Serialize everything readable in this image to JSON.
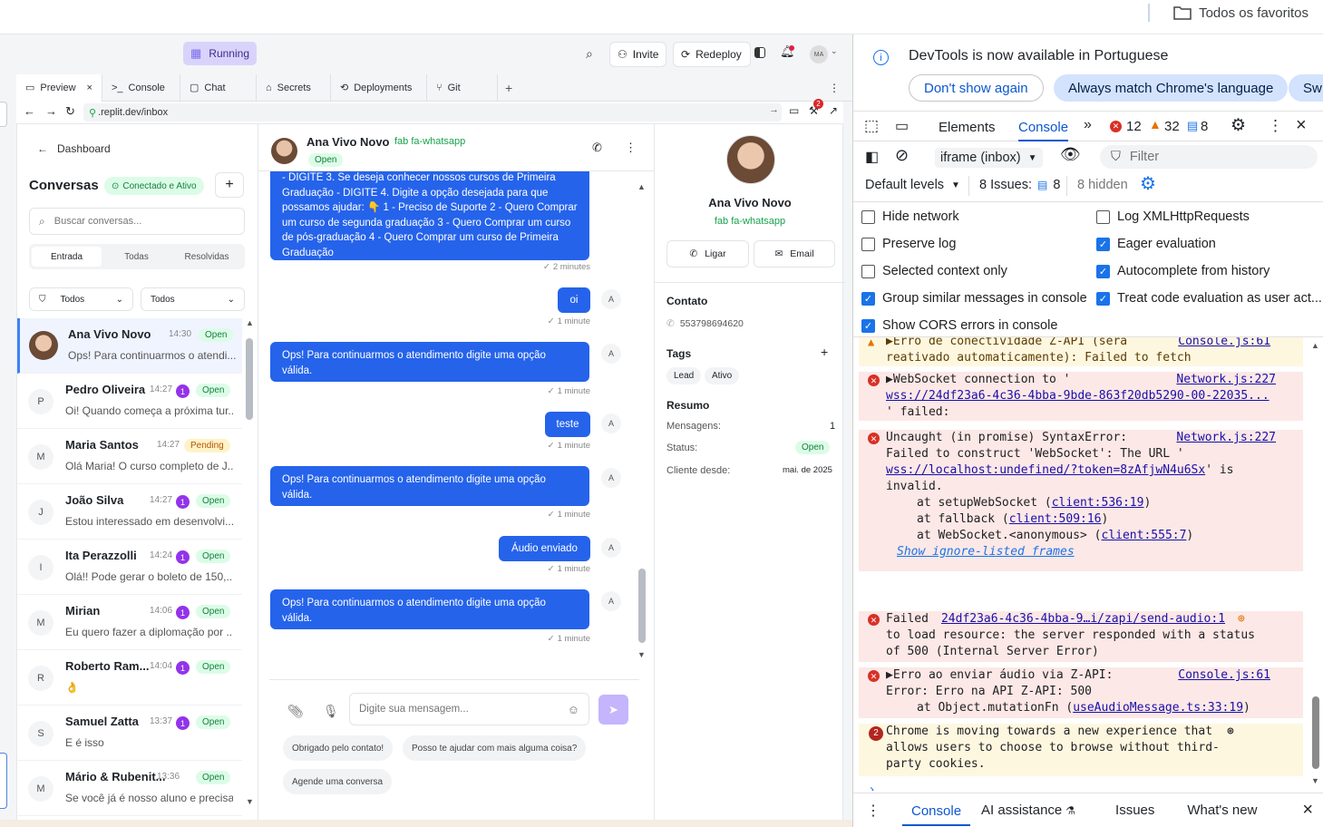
{
  "browser": {
    "favorites": "Todos os favoritos"
  },
  "replit": {
    "running": "Running",
    "invite": "Invite",
    "redeploy": "Redeploy",
    "avatar": "MA",
    "tabs": [
      {
        "label": "Preview"
      },
      {
        "label": "Console"
      },
      {
        "label": "Chat"
      },
      {
        "label": "Secrets"
      },
      {
        "label": "Deployments"
      },
      {
        "label": "Git"
      }
    ],
    "url": ".replit.dev/inbox",
    "notif_count": "2"
  },
  "sidebar": {
    "dashboard": "Dashboard",
    "title": "Conversas",
    "status": "Conectado e Ativo",
    "search_placeholder": "Buscar conversas...",
    "tabs": [
      "Entrada",
      "Todas",
      "Resolvidas"
    ],
    "filter1": "Todos",
    "filter2": "Todos",
    "conversations": [
      {
        "initial": "",
        "name": "Ana Vivo Novo",
        "time": "14:30",
        "count": "",
        "status": "Open",
        "preview": "Ops! Para continuarmos o atendi..."
      },
      {
        "initial": "P",
        "name": "Pedro Oliveira",
        "time": "14:27",
        "count": "1",
        "status": "Open",
        "preview": "Oi! Quando começa a próxima tur..."
      },
      {
        "initial": "M",
        "name": "Maria Santos",
        "time": "14:27",
        "count": "",
        "status": "Pending",
        "preview": "Olá Maria! O curso completo de J..."
      },
      {
        "initial": "J",
        "name": "João Silva",
        "time": "14:27",
        "count": "1",
        "status": "Open",
        "preview": "Estou interessado em desenvolvi..."
      },
      {
        "initial": "I",
        "name": "Ita Perazzolli",
        "time": "14:24",
        "count": "1",
        "status": "Open",
        "preview": "Olá!! Pode gerar o boleto de 150,..."
      },
      {
        "initial": "M",
        "name": "Mirian",
        "time": "14:06",
        "count": "1",
        "status": "Open",
        "preview": "Eu quero fazer a diplomação por ..."
      },
      {
        "initial": "R",
        "name": "Roberto Ram...",
        "time": "14:04",
        "count": "1",
        "status": "Open",
        "preview": "👌"
      },
      {
        "initial": "S",
        "name": "Samuel Zatta",
        "time": "13:37",
        "count": "1",
        "status": "Open",
        "preview": "E é isso"
      },
      {
        "initial": "M",
        "name": "Mário & Rubenit...",
        "time": "13:36",
        "count": "",
        "status": "Open",
        "preview": "Se você já é nosso aluno e precisa..."
      }
    ]
  },
  "chat": {
    "name": "Ana Vivo Novo",
    "channel": "fab fa-whatsapp",
    "status": "Open",
    "messages": [
      {
        "text": "- DIGITE 3. Se deseja conhecer nossos cursos de Primeira Graduação - DIGITE 4. Digite a opção desejada para que possamos ajudar: 👇 1 - Preciso de Suporte 2 - Quero Comprar um curso de segunda graduação 3 - Quero Comprar um curso de pós-graduação 4 - Quero Comprar um curso de Primeira Graduação",
        "meta": "2 minutes",
        "side": "left"
      },
      {
        "text": "oi",
        "meta": "1 minute",
        "side": "right"
      },
      {
        "text": "Ops! Para continuarmos o atendimento digite uma opção válida.",
        "meta": "1 minute",
        "side": "left"
      },
      {
        "text": "teste",
        "meta": "1 minute",
        "side": "right"
      },
      {
        "text": "Ops! Para continuarmos o atendimento digite uma opção válida.",
        "meta": "1 minute",
        "side": "left"
      },
      {
        "text": "Áudio enviado",
        "meta": "1 minute",
        "side": "right"
      },
      {
        "text": "Ops! Para continuarmos o atendimento digite uma opção válida.",
        "meta": "1 minute",
        "side": "left"
      }
    ],
    "avatar_letter": "A",
    "input_placeholder": "Digite sua mensagem...",
    "quick_replies": [
      "Obrigado pelo contato!",
      "Posso te ajudar com mais alguma coisa?",
      "Agende uma conversa"
    ]
  },
  "contact": {
    "name": "Ana Vivo Novo",
    "channel": "fab fa-whatsapp",
    "call": "Ligar",
    "email": "Email",
    "contact_title": "Contato",
    "phone": "553798694620",
    "tags_title": "Tags",
    "tags": [
      "Lead",
      "Ativo"
    ],
    "summary_title": "Resumo",
    "messages_label": "Mensagens:",
    "messages_value": "1",
    "status_label": "Status:",
    "status_value": "Open",
    "since_label": "Cliente desde:",
    "since_value": "mai. de 2025"
  },
  "devtools": {
    "banner": "DevTools is now available in Portuguese",
    "dont_show": "Don't show again",
    "match": "Always match Chrome's language",
    "switch": "Sw",
    "tabs": {
      "elements": "Elements",
      "console": "Console"
    },
    "errors": "12",
    "warnings": "32",
    "messages": "8",
    "context": "iframe (inbox)",
    "filter_placeholder": "Filter",
    "levels": "Default levels",
    "issues_label": "8 Issues:",
    "issues_count": "8",
    "hidden": "8 hidden",
    "settings": [
      {
        "label": "Hide network",
        "checked": false
      },
      {
        "label": "Log XMLHttpRequests",
        "checked": false
      },
      {
        "label": "Preserve log",
        "checked": false
      },
      {
        "label": "Eager evaluation",
        "checked": true
      },
      {
        "label": "Selected context only",
        "checked": false
      },
      {
        "label": "Autocomplete from history",
        "checked": true
      },
      {
        "label": "Group similar messages in console",
        "checked": true
      },
      {
        "label": "Treat code evaluation as user act...",
        "checked": true
      },
      {
        "label": "Show CORS errors in console",
        "checked": true
      }
    ],
    "log": {
      "m1": "▶Erro de conectividade Z-API (será",
      "m1b": "reativado automaticamente): Failed to fetch",
      "m1src": "Console.js:61",
      "m2": "▶WebSocket connection to '",
      "m2src": "Network.js:227",
      "m2url": "wss://24df23a6-4c36-4bba-9bde-863f20db5290-00-22035...",
      "m2end": "' failed:",
      "m3a": "Uncaught (in promise) SyntaxError:",
      "m3src": "Network.js:227",
      "m3b": "Failed to construct 'WebSocket': The URL '",
      "m3url": "wss://localhost:undefined/?token=8zAfjwN4u6Sx",
      "m3c": "' is",
      "m3d": "invalid.",
      "m3e": "at setupWebSocket (",
      "m3e_l": "client:536:19",
      "m3f": "at fallback (",
      "m3f_l": "client:509:16",
      "m3g": "at WebSocket.<anonymous> (",
      "m3g_l": "client:555:7",
      "m3h": "Show ignore-listed frames",
      "m4a": "Failed",
      "m4url": "24df23a6-4c36-4bba-9…i/zapi/send-audio:1",
      "m4b": "to load resource: the server responded with a status",
      "m4c": "of 500 (Internal Server Error)",
      "m5a": "▶Erro ao enviar áudio via Z-API:",
      "m5src": "Console.js:61",
      "m5b": "Error: Erro na API Z-API: 500",
      "m5c": "at Object.mutationFn (",
      "m5c_l": "useAudioMessage.ts:33:19",
      "m6count": "2",
      "m6a": "Chrome is moving towards a new experience that",
      "m6b": "allows users to choose to browse without third-",
      "m6c": "party cookies."
    },
    "drawer": [
      "Console",
      "AI assistance",
      "Issues",
      "What's new"
    ]
  }
}
